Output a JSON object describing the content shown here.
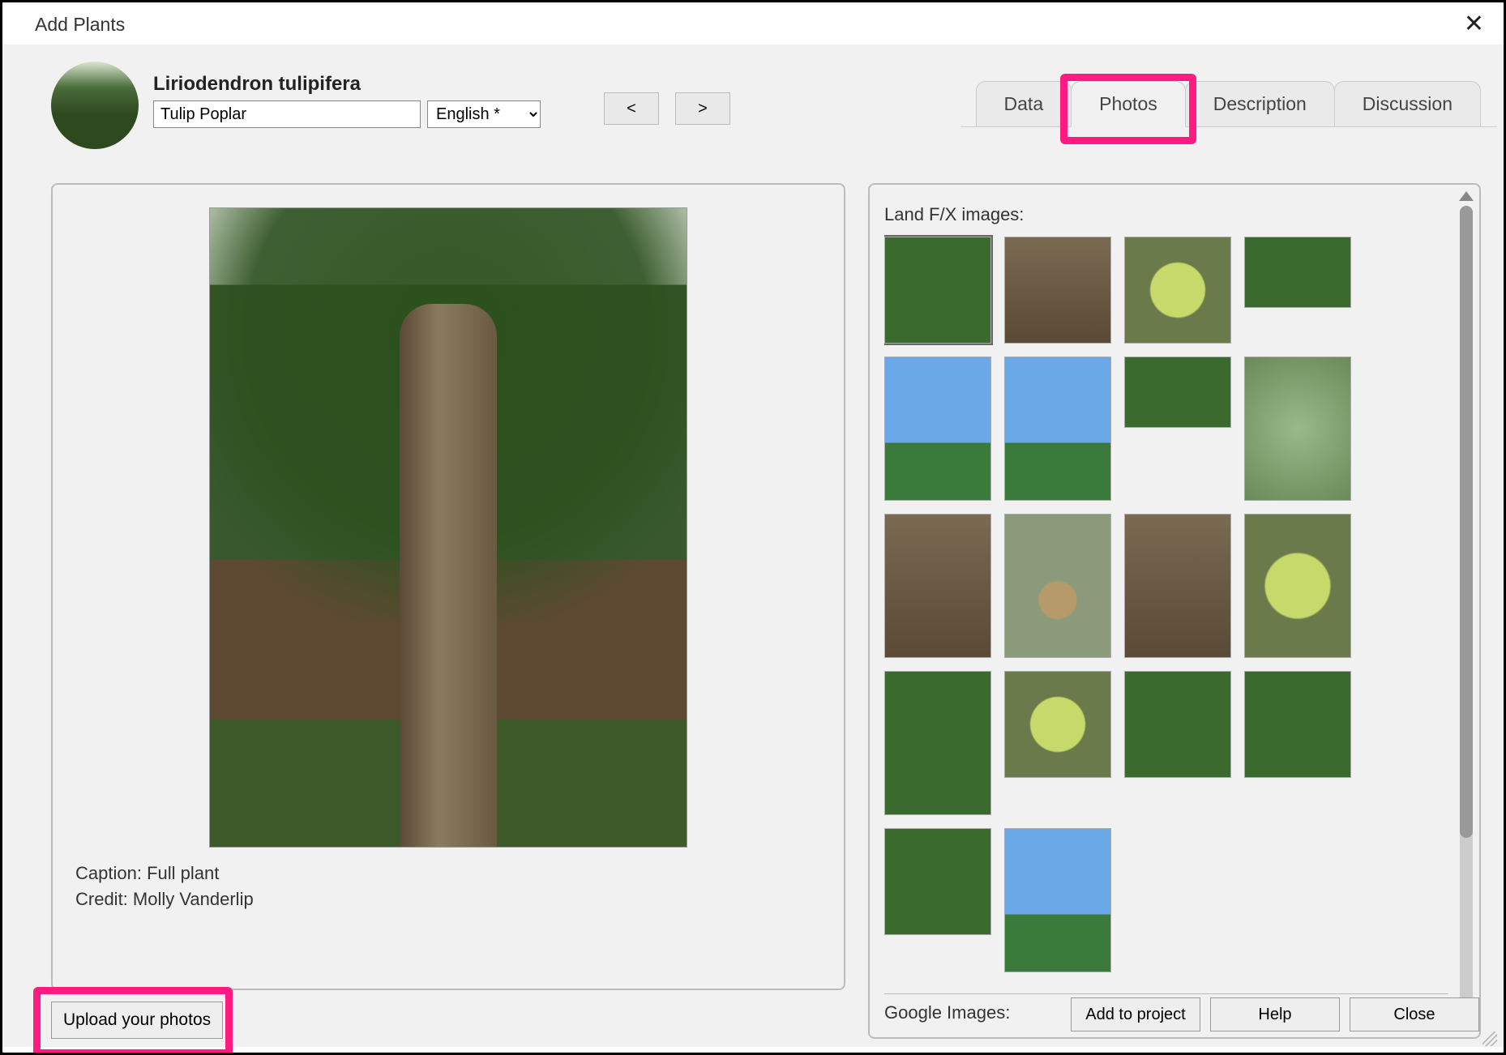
{
  "window": {
    "title": "Add Plants"
  },
  "plant": {
    "scientific_name": "Liriodendron tulipifera",
    "common_name": "Tulip Poplar",
    "language": "English *"
  },
  "nav": {
    "prev": "<",
    "next": ">"
  },
  "tabs": {
    "data": "Data",
    "photos": "Photos",
    "description": "Description",
    "discussion": "Discussion",
    "active": "photos"
  },
  "preview": {
    "caption_label": "Caption:",
    "caption_value": "Full plant",
    "credit_label": "Credit:",
    "credit_value": "Molly Vanderlip"
  },
  "upload_label": "Upload your photos",
  "gallery": {
    "section1_label": "Land F/X images:",
    "section2_label": "Google Images:",
    "thumbs": [
      {
        "cls": "c-green",
        "h": "",
        "sel": true
      },
      {
        "cls": "c-bark",
        "h": ""
      },
      {
        "cls": "c-leaf",
        "h": ""
      },
      {
        "cls": "c-green",
        "h": "short"
      },
      {
        "cls": "c-sky",
        "h": "tall"
      },
      {
        "cls": "c-sky",
        "h": "tall"
      },
      {
        "cls": "c-green",
        "h": "short"
      },
      {
        "cls": "c-blur",
        "h": "tall"
      },
      {
        "cls": "c-bark",
        "h": "tall"
      },
      {
        "cls": "c-seed",
        "h": "tall"
      },
      {
        "cls": "c-bark",
        "h": "tall"
      },
      {
        "cls": "c-leaf",
        "h": "tall"
      },
      {
        "cls": "c-green",
        "h": "tall"
      },
      {
        "cls": "c-leaf",
        "h": ""
      },
      {
        "cls": "c-green",
        "h": ""
      },
      {
        "cls": "c-green",
        "h": ""
      },
      {
        "cls": "c-green",
        "h": ""
      },
      {
        "cls": "c-sky",
        "h": "tall"
      }
    ]
  },
  "footer": {
    "add": "Add to project",
    "help": "Help",
    "close": "Close"
  }
}
